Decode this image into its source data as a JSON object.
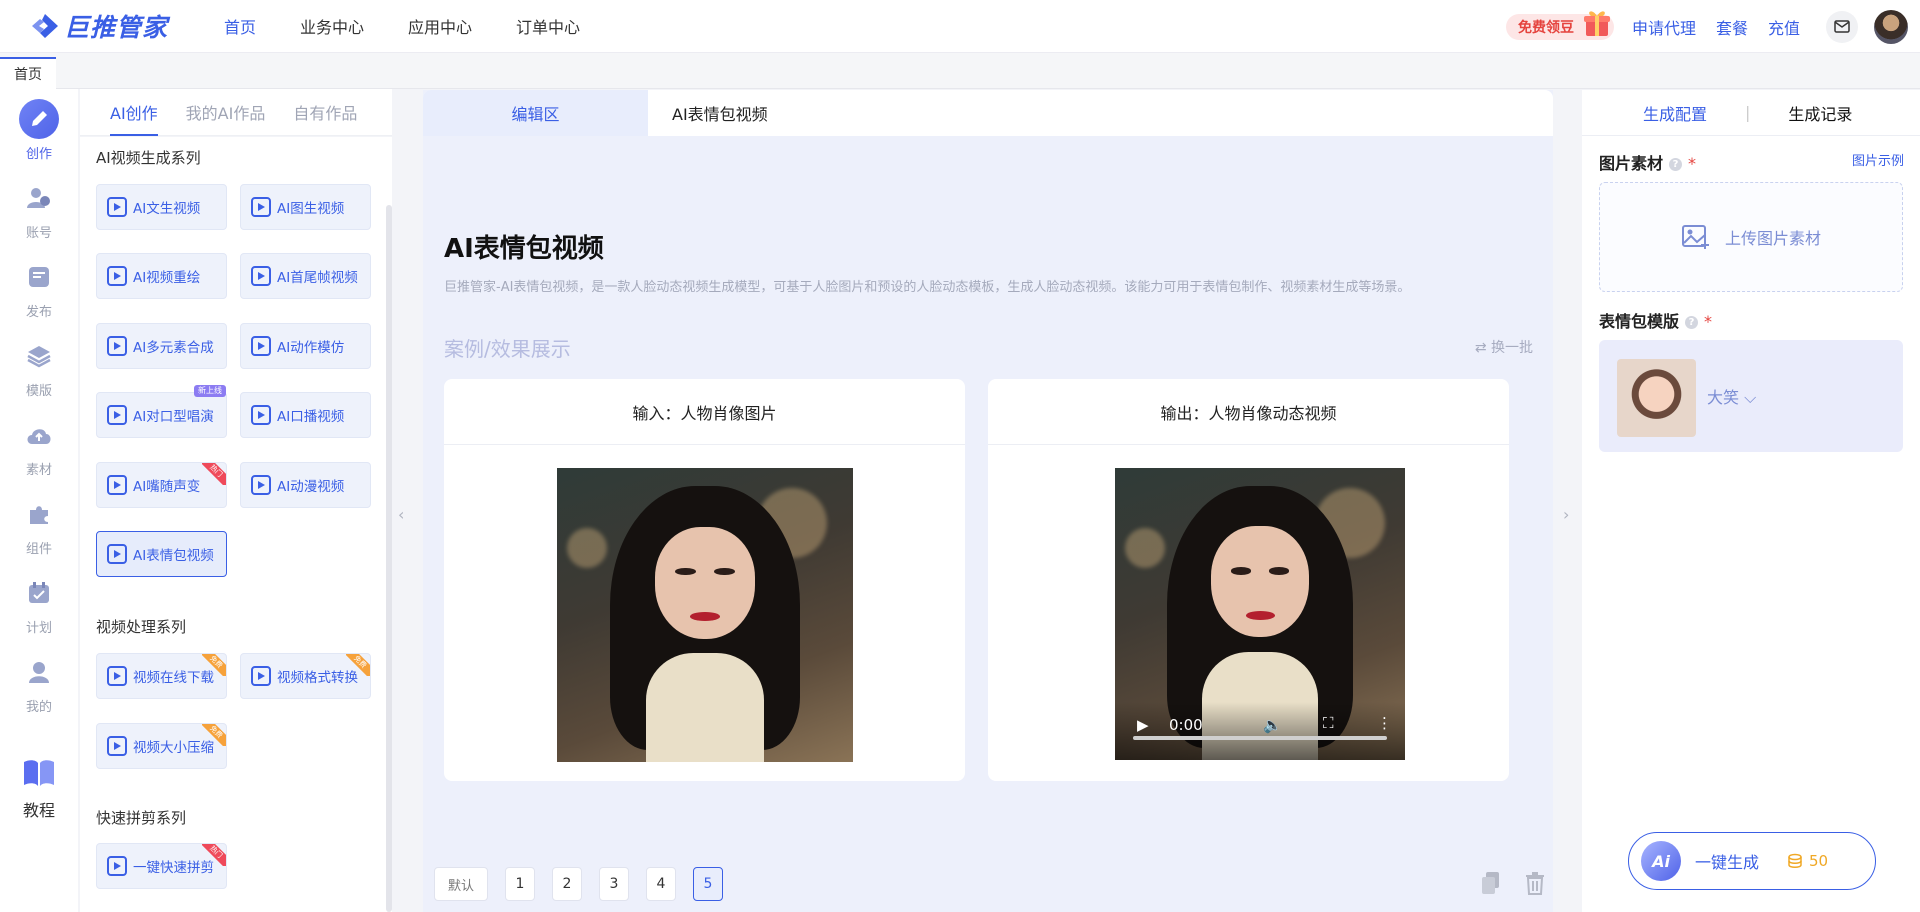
{
  "header": {
    "brand": "巨推管家",
    "nav": [
      "首页",
      "业务中心",
      "应用中心",
      "订单中心"
    ],
    "free_bean": "免费领豆",
    "links": [
      "申请代理",
      "套餐",
      "充值"
    ]
  },
  "tabs": {
    "home": "首页"
  },
  "rail": [
    {
      "label": "创作",
      "icon": "pencil-icon"
    },
    {
      "label": "账号",
      "icon": "users-icon"
    },
    {
      "label": "发布",
      "icon": "publish-icon"
    },
    {
      "label": "模版",
      "icon": "layers-icon"
    },
    {
      "label": "素材",
      "icon": "cloud-upload-icon"
    },
    {
      "label": "组件",
      "icon": "puzzle-icon"
    },
    {
      "label": "计划",
      "icon": "calendar-icon"
    },
    {
      "label": "我的",
      "icon": "user-icon"
    },
    {
      "label": "教程",
      "icon": "book-icon"
    }
  ],
  "left_tabs": [
    "AI创作",
    "我的AI作品",
    "自有作品"
  ],
  "sections": {
    "ai_video": "AI视频生成系列",
    "video_process": "视频处理系列",
    "quick_edit": "快速拼剪系列"
  },
  "tools": {
    "ai_video": [
      "AI文生视频",
      "AI图生视频",
      "AI视频重绘",
      "AI首尾帧视频",
      "AI多元素合成",
      "AI动作模仿",
      "AI对口型唱演",
      "AI口播视频",
      "AI嘴随声变",
      "AI动漫视频",
      "AI表情包视频"
    ],
    "video_process": [
      "视频在线下载",
      "视频格式转换",
      "视频大小压缩"
    ],
    "quick_edit": [
      "一键快速拼剪"
    ]
  },
  "center": {
    "tab_edit": "编辑区",
    "tab_name": "AI表情包视频",
    "title": "AI表情包视频",
    "description": "巨推管家-AI表情包视频，是一款人脸动态视频生成模型，可基于人脸图片和预设的人脸动态模板，生成人脸动态视频。该能力可用于表情包制作、视频素材生成等场景。",
    "showcase": "案例/效果展示",
    "refresh": "换一批",
    "input_label": "输入：人物肖像图片",
    "output_label": "输出：人物肖像动态视频",
    "video_time": "0:00",
    "pager": [
      "默认",
      "1",
      "2",
      "3",
      "4",
      "5"
    ],
    "pager_active": "5"
  },
  "right": {
    "tab_config": "生成配置",
    "tab_record": "生成记录",
    "image_label": "图片素材",
    "image_example": "图片示例",
    "upload": "上传图片素材",
    "template_label": "表情包模版",
    "template_value": "大笑",
    "generate": "一键生成",
    "cost": "50"
  },
  "colors": {
    "accent": "#3a5fe5",
    "required": "#e5443f",
    "coin": "#f0a825"
  }
}
